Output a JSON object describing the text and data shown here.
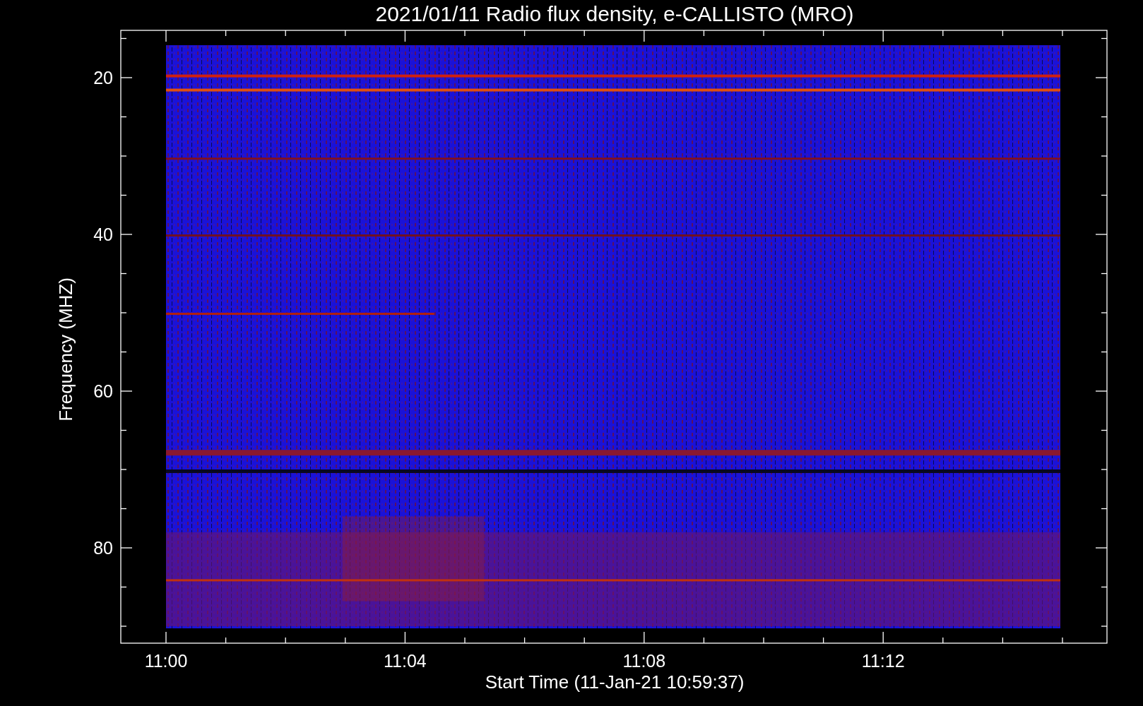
{
  "title": "2021/01/11  Radio flux density, e-CALLISTO (MRO)",
  "y_axis": {
    "label": "Frequency (MHZ)",
    "ticks": [
      "20",
      "40",
      "60",
      "80"
    ]
  },
  "x_axis": {
    "label": "Start Time (11-Jan-21 10:59:37)",
    "ticks": [
      "11:00",
      "11:04",
      "11:08",
      "11:12"
    ]
  }
}
